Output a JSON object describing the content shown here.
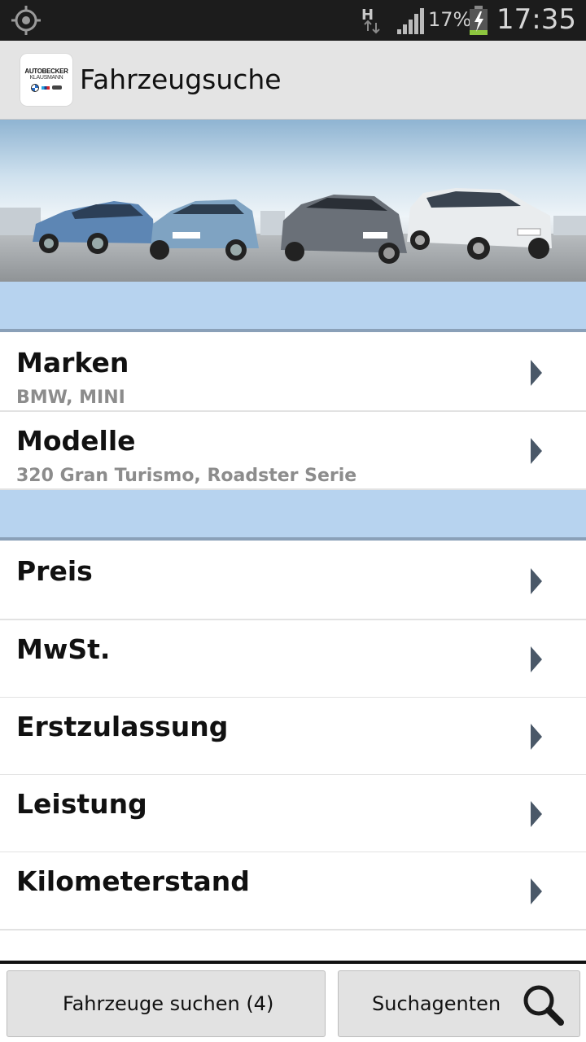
{
  "status_bar": {
    "network_label": "H",
    "battery_percent": "17%",
    "time": "17:35",
    "icons": [
      "gps-icon",
      "data-arrows-icon",
      "signal-icon",
      "battery-charging-icon"
    ]
  },
  "action_bar": {
    "logo": {
      "line1": "AUTOBECKER",
      "line2": "KLAUSMANN"
    },
    "title": "Fahrzeugsuche"
  },
  "sections": [
    {
      "rows": [
        {
          "label": "Marken",
          "value": "BMW, MINI"
        },
        {
          "label": "Modelle",
          "value": "320 Gran Turismo, Roadster Serie"
        }
      ]
    },
    {
      "rows": [
        {
          "label": "Preis",
          "value": ""
        },
        {
          "label": "MwSt.",
          "value": ""
        },
        {
          "label": "Erstzulassung",
          "value": ""
        },
        {
          "label": "Leistung",
          "value": ""
        },
        {
          "label": "Kilometerstand",
          "value": ""
        }
      ]
    }
  ],
  "bottom_bar": {
    "search_button": "Fahrzeuge suchen (4)",
    "agent_button": "Suchagenten",
    "agent_icon": "magnifier-icon"
  },
  "colors": {
    "section_header": "#b7d3ef",
    "action_bar": "#e4e4e4",
    "status_bar": "#1c1c1c",
    "chevron": "#4a5868"
  }
}
